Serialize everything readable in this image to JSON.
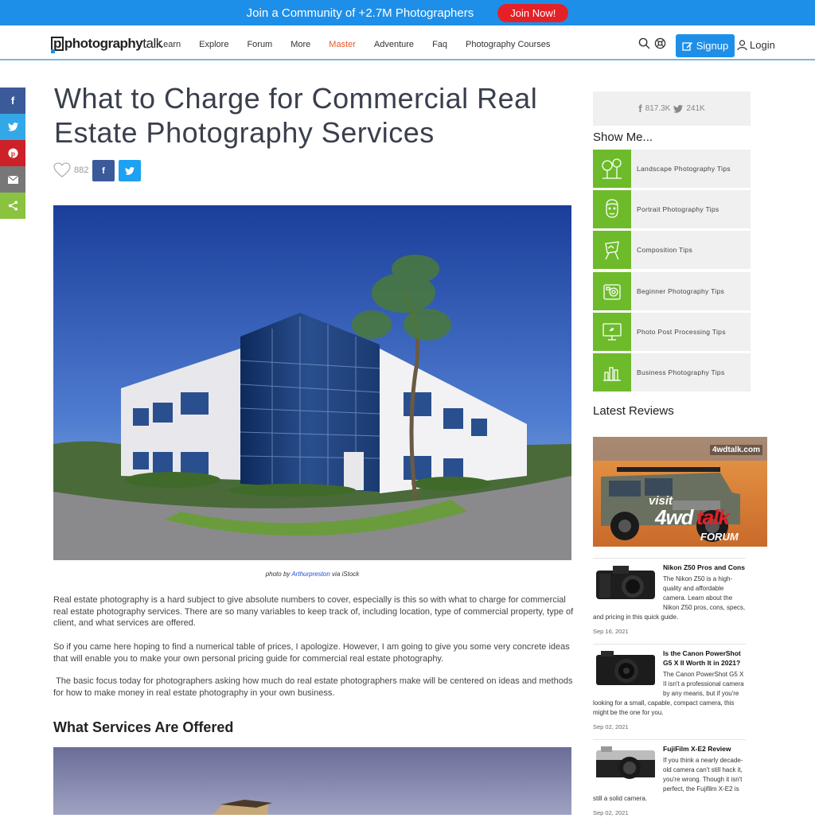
{
  "banner": {
    "text": "Join a Community of +2.7M Photographers",
    "button": "Join Now!"
  },
  "nav": {
    "logo_main": "photography",
    "logo_accent": "talk",
    "links": [
      "Learn",
      "Explore",
      "Forum",
      "More",
      "Master",
      "Adventure",
      "Faq",
      "Photography Courses"
    ],
    "active_link": "Master",
    "signup": "Signup",
    "login": "Login"
  },
  "share": {
    "items": [
      "facebook",
      "twitter",
      "pinterest",
      "email",
      "share"
    ]
  },
  "article": {
    "title": "What to Charge for Commercial Real Estate Photography Services",
    "likes": "882",
    "caption_prefix": "photo by",
    "caption_author": "Arthurpreston",
    "caption_suffix": "via iStock",
    "paragraphs": [
      "Real estate photography is a hard subject to give absolute numbers to cover, especially is this so with what to charge for commercial real estate photography services. There are so many variables to keep track of, including location, type of commercial property, type of client, and what services are offered.",
      "So if you came here hoping to find a numerical table of prices, I apologize. However, I am going to give you some very concrete ideas that will enable you to make your own personal pricing guide for commercial real estate photography.",
      " The basic focus today for photographers asking how much do real estate photographers make will be centered on ideas and methods for how to make money in real estate photography in your own business."
    ],
    "section_heading": "What Services Are Offered"
  },
  "sidebar": {
    "facebook_count": "817.3K",
    "twitter_count": "241K",
    "show_me": "Show Me...",
    "tips": [
      "Landscape Photography Tips",
      "Portrait Photography Tips",
      "Composition Tips",
      "Beginner Photography Tips",
      "Photo Post Processing Tips",
      "Business Photography Tips"
    ],
    "latest_reviews": "Latest Reviews",
    "ad": {
      "site": "4wdtalk.com",
      "line1": "visit",
      "line2": "4wd",
      "line3": "talk",
      "line4": "FORUM"
    },
    "reviews": [
      {
        "title": "Nikon Z50 Pros and Cons",
        "text": "The Nikon Z50 is a high-quality and affordable camera. Learn about the Nikon Z50 pros, cons, specs, and pricing in this quick guide.",
        "date": "Sep 16, 2021"
      },
      {
        "title": "Is the Canon PowerShot G5 X II Worth It in 2021?",
        "text": "The Canon PowerShot G5 X II isn't a professional camera by any means, but if you're looking for a small, capable, compact camera, this might be the one for you.",
        "date": "Sep 02, 2021"
      },
      {
        "title": "FujiFilm X-E2 Review",
        "text": "If you think a nearly decade-old camera can't still hack it, you're wrong. Though it isn't perfect, the Fujifilm X-E2 is still a solid camera.",
        "date": "Sep 02, 2021"
      }
    ]
  },
  "colors": {
    "brand_blue": "#1e8fe8",
    "join_red": "#e62027",
    "tip_green": "#6dbb2a",
    "active_orange": "#e8562a"
  }
}
